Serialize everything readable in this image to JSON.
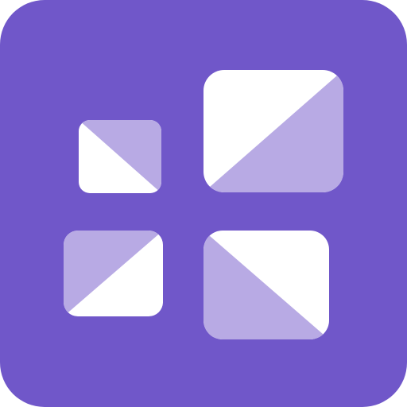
{
  "icon": {
    "name": "windows-grid-app-icon",
    "colors": {
      "background": "#7057C9",
      "tile_white": "#FFFFFF",
      "tile_light": "#B8AAE4"
    },
    "tiles": [
      {
        "name": "tile-top-left-small",
        "split": "diagonal"
      },
      {
        "name": "tile-top-right-large",
        "split": "diagonal"
      },
      {
        "name": "tile-bottom-left",
        "split": "diagonal"
      },
      {
        "name": "tile-bottom-right",
        "split": "diagonal"
      }
    ]
  }
}
